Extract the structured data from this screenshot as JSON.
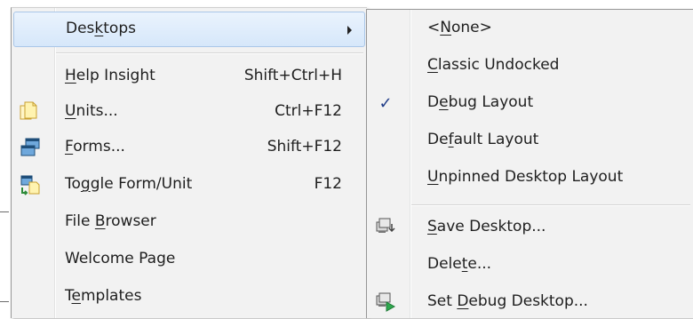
{
  "left_menu": {
    "desktops": {
      "label_pre": "Des",
      "label_ul": "k",
      "label_post": "tops"
    },
    "help_insight": {
      "label_pre": "",
      "label_ul": "H",
      "label_post": "elp Insight",
      "shortcut": "Shift+Ctrl+H"
    },
    "units": {
      "label_pre": "",
      "label_ul": "U",
      "label_post": "nits...",
      "shortcut": "Ctrl+F12",
      "icon": "units-icon"
    },
    "forms": {
      "label_pre": "",
      "label_ul": "F",
      "label_post": "orms...",
      "shortcut": "Shift+F12",
      "icon": "forms-icon"
    },
    "toggle": {
      "label_pre": "To",
      "label_ul": "g",
      "label_post": "gle Form/Unit",
      "shortcut": "F12",
      "icon": "toggle-form-unit-icon"
    },
    "file_browser": {
      "label_pre": "File ",
      "label_ul": "B",
      "label_post": "rowser"
    },
    "welcome_page": {
      "label_pre": "Welcome Page",
      "label_ul": "",
      "label_post": ""
    },
    "templates": {
      "label_pre": "T",
      "label_ul": "e",
      "label_post": "mplates"
    }
  },
  "right_menu": {
    "none": {
      "label_pre": "<",
      "label_ul": "N",
      "label_post": "one>"
    },
    "classic": {
      "label_pre": "",
      "label_ul": "C",
      "label_post": "lassic Undocked"
    },
    "debug_layout": {
      "label_pre": "D",
      "label_ul": "e",
      "label_post": "bug Layout",
      "checked": "✓"
    },
    "default_layout": {
      "label_pre": "De",
      "label_ul": "f",
      "label_post": "ault Layout"
    },
    "unpinned": {
      "label_pre": "",
      "label_ul": "U",
      "label_post": "npinned Desktop Layout"
    },
    "save": {
      "label_pre": "",
      "label_ul": "S",
      "label_post": "ave Desktop...",
      "icon": "save-desktop-icon"
    },
    "delete": {
      "label_pre": "Dele",
      "label_ul": "t",
      "label_post": "e..."
    },
    "set_debug": {
      "label_pre": "Set ",
      "label_ul": "D",
      "label_post": "ebug Desktop...",
      "icon": "set-debug-desktop-icon"
    }
  }
}
